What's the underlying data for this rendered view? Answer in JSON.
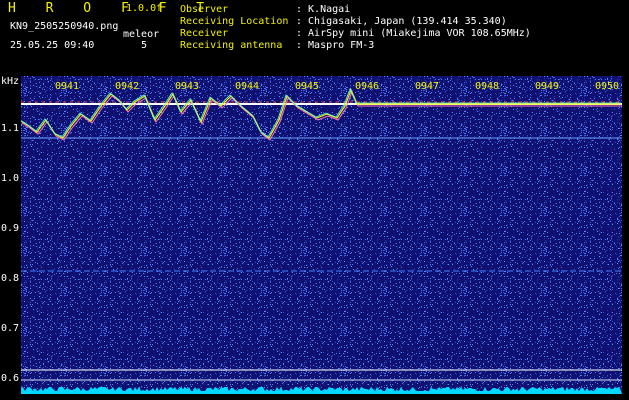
{
  "header": {
    "app_name": "H R O F F T",
    "version": "1.0.0f",
    "filename": "KN9_2505250940.png",
    "datetime": "25.05.25 09:40",
    "mode_label": "meleor",
    "mode_value": "5",
    "info": [
      {
        "label": "Observer",
        "value": ": K.Nagai"
      },
      {
        "label": "Receiving Location",
        "value": ": Chigasaki, Japan (139.414 35.340)"
      },
      {
        "label": "Receiver",
        "value": ": AirSpy mini (Miakejima VOR 108.65MHz)"
      },
      {
        "label": "Receiving antenna",
        "value": ": Maspro FM-3"
      }
    ]
  },
  "spectrogram": {
    "unit_label": "kHz",
    "y_ticks": [
      "1.1",
      "1.0",
      "0.9",
      "0.8",
      "0.7",
      "0.6"
    ],
    "x_ticks": [
      "0941",
      "0942",
      "0943",
      "0944",
      "0945",
      "0946",
      "0947",
      "0948",
      "0949",
      "0950"
    ],
    "colors": {
      "background": "#101070",
      "noise": "#3050d0",
      "trace": "#f2f200",
      "line": "#ffffff"
    }
  }
}
